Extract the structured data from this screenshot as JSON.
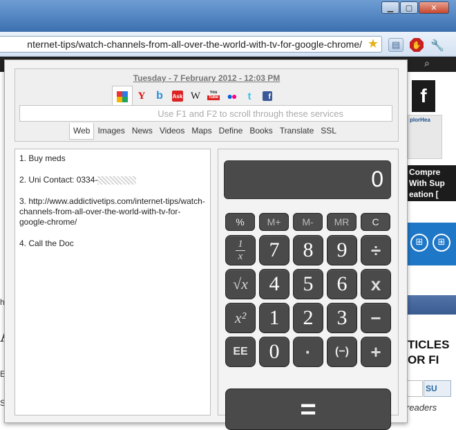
{
  "window": {
    "minimize_icon": "minimize-icon",
    "maximize_icon": "maximize-icon",
    "close_icon": "close-icon"
  },
  "toolbar": {
    "url": "nternet-tips/watch-channels-from-all-over-the-world-with-tv-for-google-chrome/",
    "star_icon": "star-icon",
    "extension_icons": [
      "notes-extension-icon",
      "adblock-icon",
      "wrench-icon"
    ]
  },
  "background_page": {
    "facebook_letter": "f",
    "thumb_title": "plorHea",
    "promo": [
      "Compre",
      "With Sup",
      "eation ["
    ],
    "articles": [
      "TICLES",
      "OR FI"
    ],
    "subscribe_label": "SU",
    "readers": "readers",
    "left_fragments": [
      "h",
      "A",
      "E",
      "S"
    ]
  },
  "popup": {
    "datetime": "Tuesday - 7 February 2012 - 12:03 PM",
    "services": [
      "google",
      "yahoo",
      "bing",
      "ask",
      "wikipedia",
      "youtube",
      "flickr",
      "twitter",
      "facebook"
    ],
    "service_glyphs": {
      "yahoo": "Y",
      "bing": "b",
      "ask": "Ask",
      "wikipedia": "W",
      "youtube_top": "You",
      "youtube_bottom": "Tube",
      "twitter": "t",
      "facebook": "f"
    },
    "search_placeholder": "Use F1 and F2 to scroll through these services",
    "search_tabs": [
      "Web",
      "Images",
      "News",
      "Videos",
      "Maps",
      "Define",
      "Books",
      "Translate",
      "SSL"
    ],
    "active_tab": "Web",
    "notes": [
      "1. Buy meds",
      "2. Uni Contact: 0334-",
      "3. http://www.addictivetips.com/internet-tips/watch-channels-from-all-over-the-world-with-tv-for-google-chrome/",
      "4. Call the Doc"
    ],
    "calculator": {
      "display": "0",
      "memory_keys": [
        "%",
        "M+",
        "M-",
        "MR",
        "C"
      ],
      "rows": [
        [
          "1/x",
          "7",
          "8",
          "9",
          "÷"
        ],
        [
          "√x",
          "4",
          "5",
          "6",
          "x"
        ],
        [
          "x²",
          "1",
          "2",
          "3",
          "−"
        ],
        [
          "EE",
          "0",
          "·",
          "(−)",
          "+"
        ]
      ],
      "equals": "="
    }
  }
}
